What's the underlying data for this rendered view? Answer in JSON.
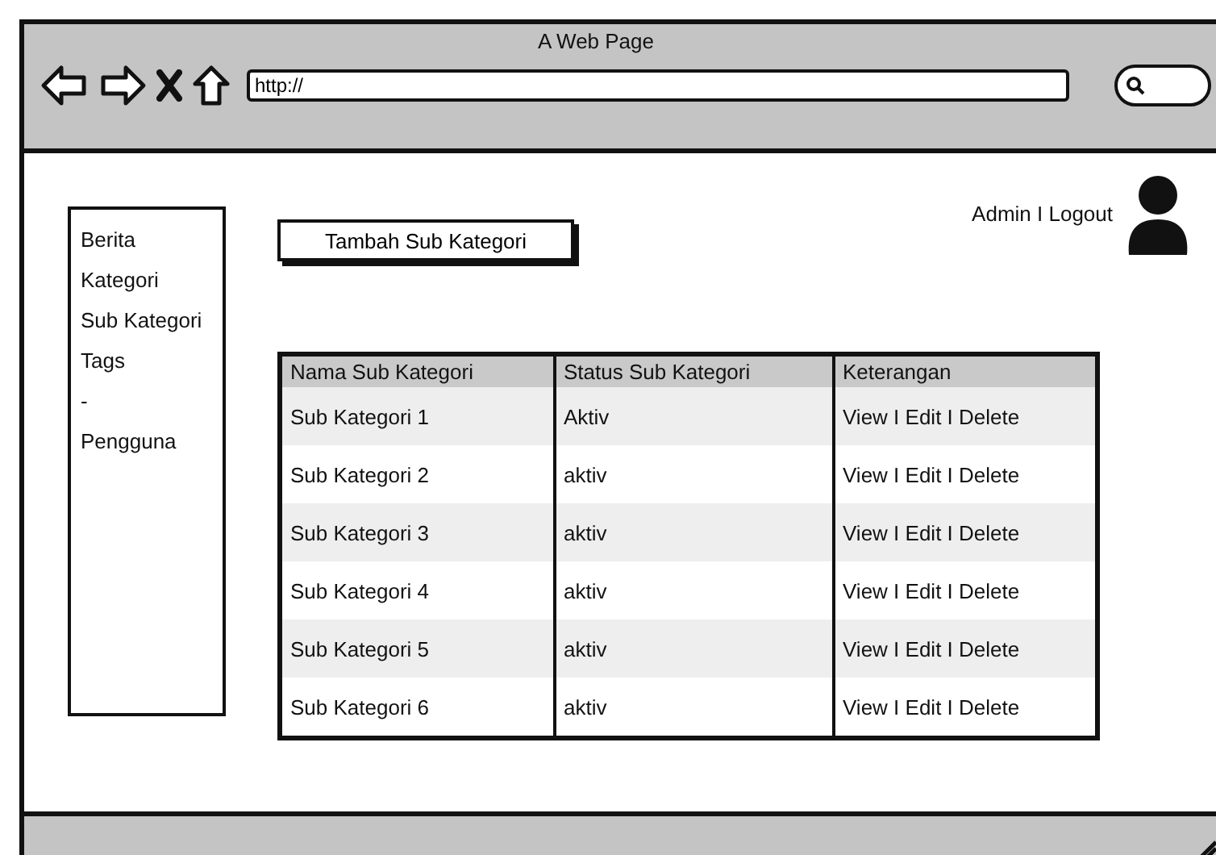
{
  "browser": {
    "title": "A Web Page",
    "url": "http://"
  },
  "sidebar": {
    "items": [
      "Berita",
      "Kategori",
      "Sub Kategori",
      "Tags",
      "-",
      "Pengguna"
    ]
  },
  "add_button": "Tambah Sub Kategori",
  "user_menu": "Admin I Logout",
  "table": {
    "columns": [
      "Nama Sub Kategori",
      "Status Sub Kategori",
      "Keterangan"
    ],
    "rows": [
      [
        "Sub Kategori 1",
        "Aktiv",
        "View I Edit I Delete"
      ],
      [
        "Sub Kategori 2",
        "aktiv",
        "View I Edit I Delete"
      ],
      [
        "Sub Kategori 3",
        "aktiv",
        "View I Edit I Delete"
      ],
      [
        "Sub Kategori 4",
        "aktiv",
        "View I Edit I Delete"
      ],
      [
        "Sub Kategori 5",
        "aktiv",
        "View I Edit I Delete"
      ],
      [
        "Sub Kategori 6",
        "aktiv",
        "View I Edit I Delete"
      ]
    ]
  }
}
